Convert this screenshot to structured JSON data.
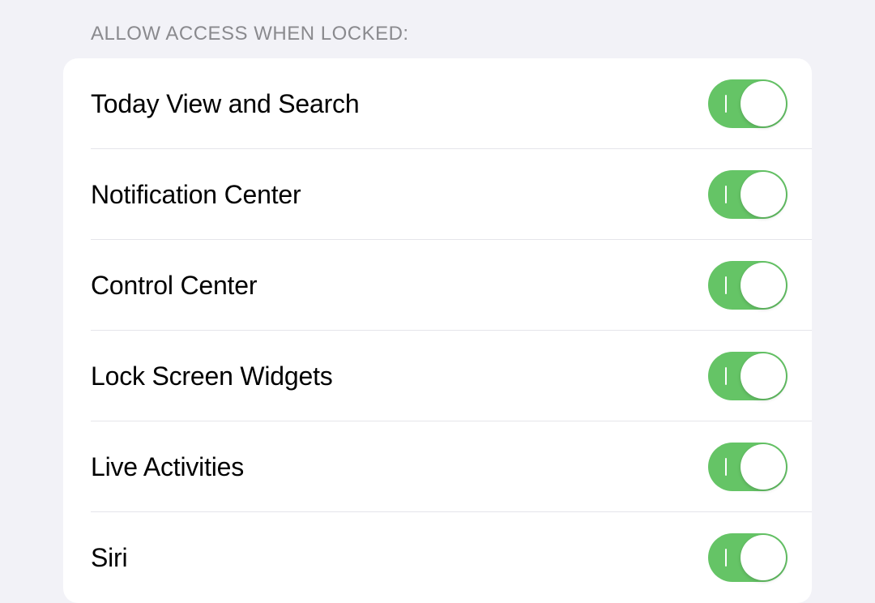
{
  "section": {
    "header": "ALLOW ACCESS WHEN LOCKED:",
    "items": [
      {
        "label": "Today View and Search",
        "enabled": true
      },
      {
        "label": "Notification Center",
        "enabled": true
      },
      {
        "label": "Control Center",
        "enabled": true
      },
      {
        "label": "Lock Screen Widgets",
        "enabled": true
      },
      {
        "label": "Live Activities",
        "enabled": true
      },
      {
        "label": "Siri",
        "enabled": true
      }
    ]
  },
  "colors": {
    "toggle_on": "#65c466",
    "background": "#f2f2f7",
    "panel": "#ffffff",
    "divider": "#e5e5ea",
    "header_text": "#8a8a8e",
    "label_text": "#000000"
  }
}
